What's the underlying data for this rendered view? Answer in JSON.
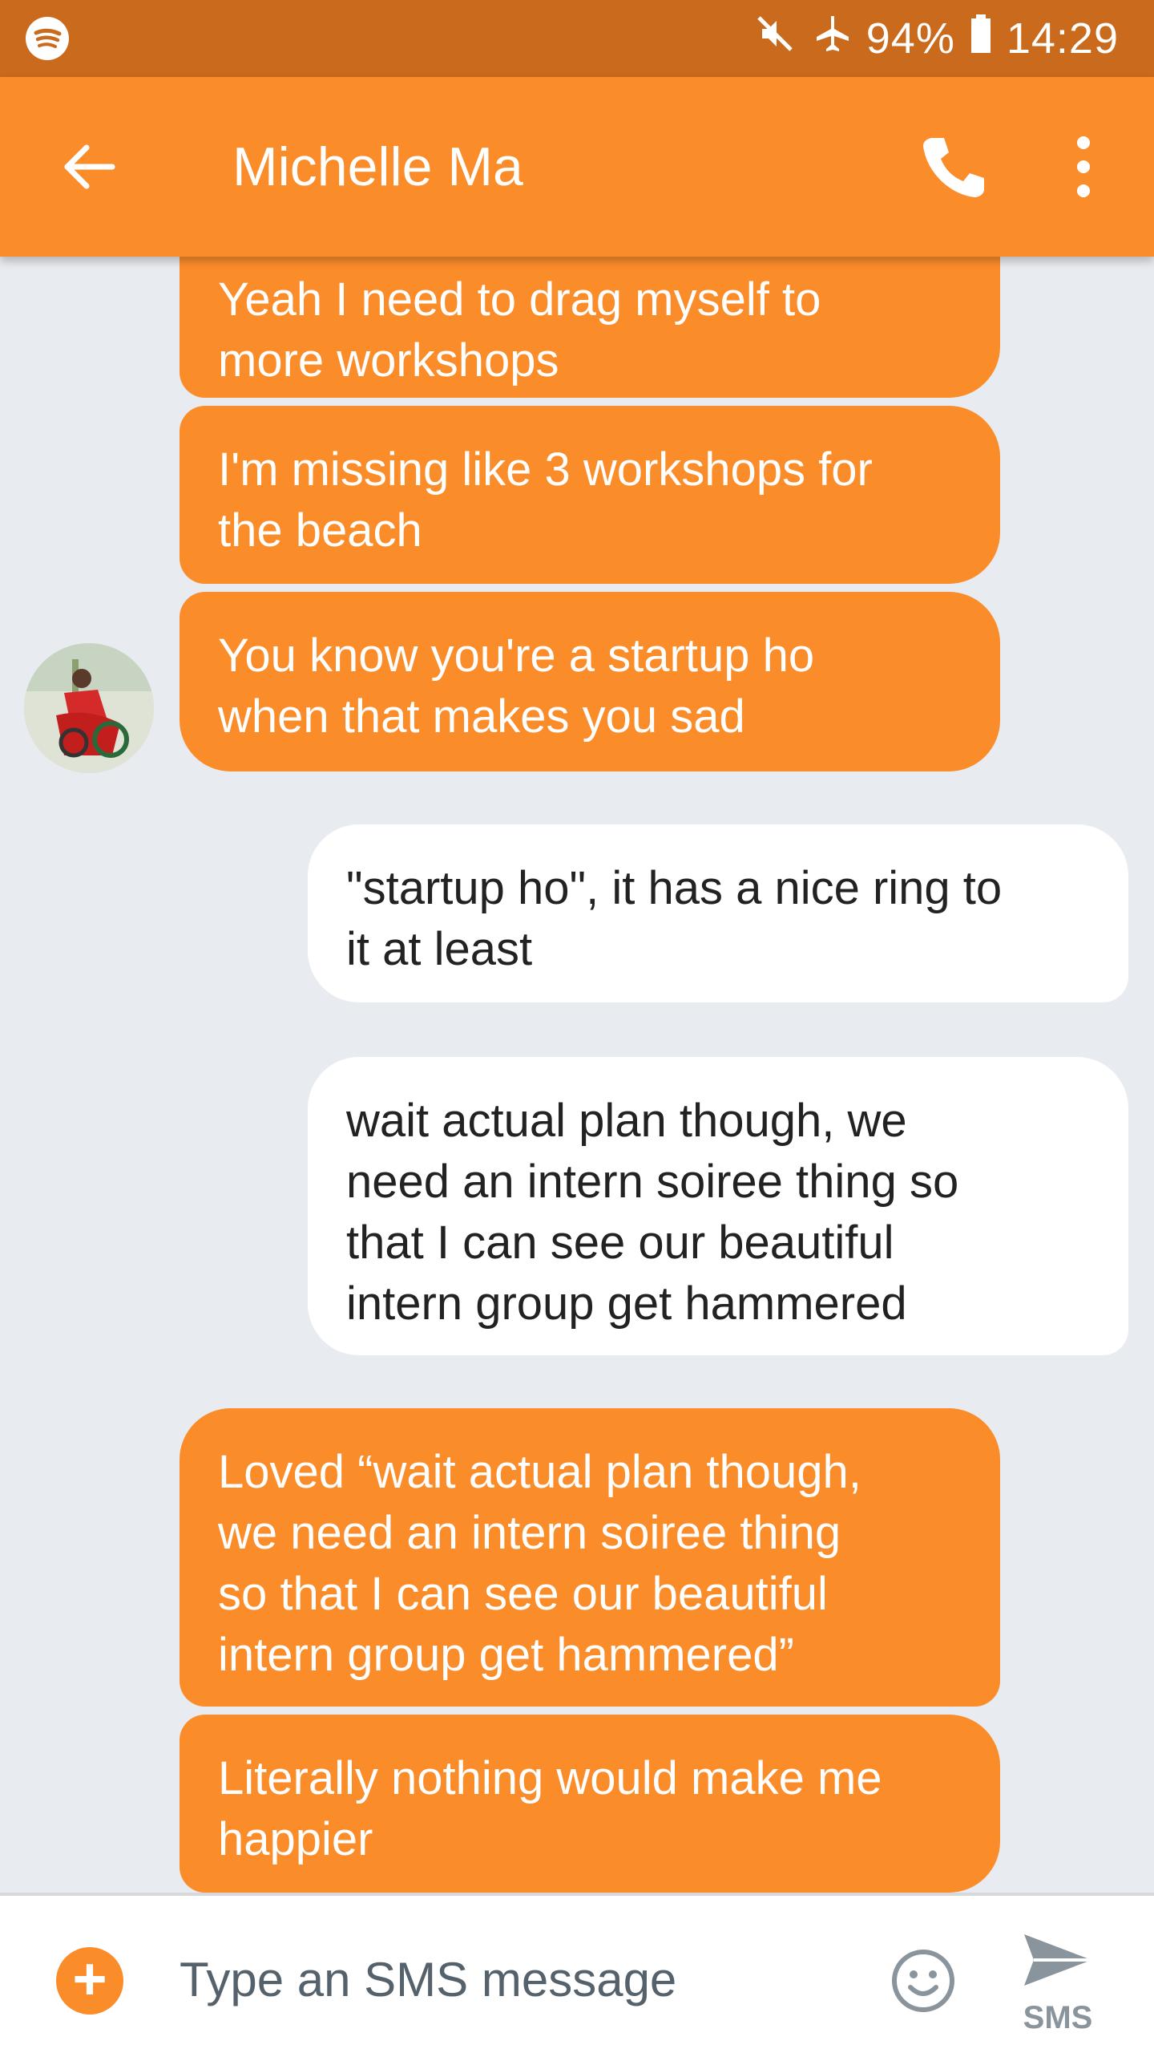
{
  "status_bar": {
    "battery": "94%",
    "time": "14:29"
  },
  "header": {
    "contact_name": "Michelle Ma"
  },
  "messages": [
    {
      "direction": "in",
      "text": "Yeah I need to drag myself to\nmore workshops"
    },
    {
      "direction": "in",
      "text": "I'm missing like 3 workshops for\nthe beach"
    },
    {
      "direction": "in",
      "text": "You know you're a startup ho\nwhen that makes you sad"
    },
    {
      "direction": "out",
      "text": "\"startup ho\", it has a nice ring to\nit at least"
    },
    {
      "direction": "out",
      "text": "wait actual plan though, we\nneed an intern soiree thing so\nthat I can see our beautiful\nintern group get hammered"
    },
    {
      "direction": "in",
      "text": "Loved “wait actual plan though,\nwe need an intern soiree thing\nso that I can see our beautiful\nintern group get hammered”"
    },
    {
      "direction": "in",
      "text": "Literally nothing would make me\nhappier"
    }
  ],
  "compose": {
    "placeholder": "Type an SMS message",
    "send_label": "SMS"
  },
  "colors": {
    "status_bar": "#c96a1c",
    "accent": "#fb8c2a",
    "thread_background": "#e8ebef",
    "outgoing_bubble": "#ffffff"
  },
  "icons": {
    "status": [
      "spotify-icon",
      "mute-icon",
      "airplane-icon",
      "battery-icon"
    ],
    "header": [
      "back-arrow-icon",
      "phone-icon",
      "more-vert-icon"
    ],
    "compose": [
      "add-icon",
      "emoji-icon",
      "send-icon"
    ]
  }
}
